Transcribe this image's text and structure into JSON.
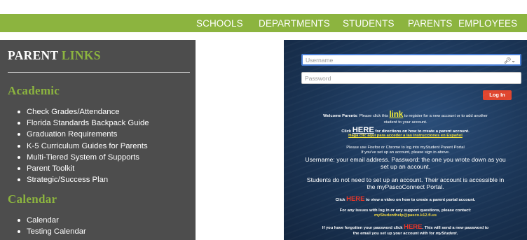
{
  "nav": {
    "items": [
      "SCHOOLS",
      "DEPARTMENTS",
      "STUDENTS",
      "PARENTS",
      "EMPLOYEES"
    ]
  },
  "sidebar": {
    "title_part1": "PARENT",
    "title_part2": "LINKS",
    "sections": [
      {
        "heading": "Academic",
        "items": [
          "Check Grades/Attendance",
          "Florida Standards Backpack Guide",
          "Graduation Requirements",
          "K-5 Curriculum Guides for Parents",
          "Multi-Tiered System of Supports",
          "Parent Toolkit",
          "Strategic/Success Plan"
        ]
      },
      {
        "heading": "Calendar",
        "items": [
          "Calendar",
          "Testing Calendar"
        ]
      }
    ]
  },
  "login": {
    "username_placeholder": "Username",
    "password_placeholder": "Password",
    "login_button": "Log In",
    "welcome_bold": "Welcome Parents",
    "welcome_pre": ": Please click this ",
    "welcome_link": "link",
    "welcome_post": " to register for a new account or to add another",
    "welcome_line2": "student to your account.",
    "click_pre": "Click ",
    "here": "HERE",
    "create_post": " for directions on how to create a parent account.",
    "spanish": "Haga clic aquí para acceder a las instrucciones en Español",
    "browser_line1": "Please use Firefox or Chrome to log into myStudent Parent Portal",
    "browser_line2": "If you've set up an account, please sign in above.",
    "creds_line1": "Username: your email address. Password: the one you wrote down as you",
    "creds_line2": "set up an account.",
    "students_line1": "Students do not need to set up an account. Their account is accessible in",
    "students_line2": "the myPascoConnect Portal.",
    "video_post": " to view a video on how to create a parent portal account.",
    "support_line": "For any issues with log in or any support questions, please contact:",
    "support_email": "myStudenthelp@pasco.k12.fl.us",
    "forgot_pre": "If you have forgotten your password click ",
    "forgot_post": ".  This will send a new password to",
    "forgot_line2_pre": "the email you set up your account with for ",
    "forgot_line2_brand": "myStudent",
    "forgot_line2_end": "."
  },
  "colors": {
    "nav_green": "#8cb43f",
    "sidebar_gray": "#4d4d4d",
    "heading_green": "#8cb43f",
    "login_blue": "#1b3556",
    "login_button_red": "#e0452e",
    "here_red": "#e5372a",
    "link_yellow": "#f3ec39"
  },
  "icons": {
    "logo": "district-logo",
    "password_manager": "key-icon"
  }
}
